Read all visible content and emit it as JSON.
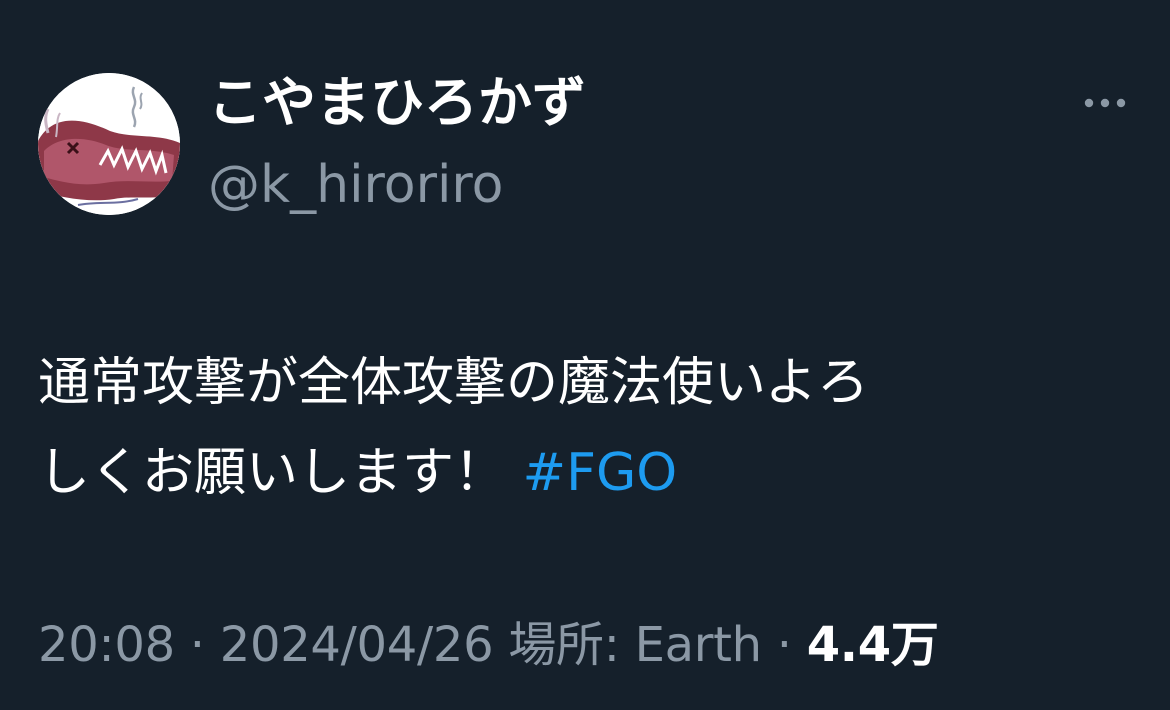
{
  "user": {
    "display_name": "こやまひろかず",
    "handle": "@k_hiroriro",
    "avatar_icon": "user-avatar-illustration"
  },
  "menu": {
    "more_icon": "more-horizontal-icon"
  },
  "tweet": {
    "text_line1": "通常攻撃が全体攻撃の魔法使いよろ",
    "text_line2": "しくお願いします！ ",
    "hashtag": "#FGO"
  },
  "meta": {
    "time": "20:08",
    "separator1": " · ",
    "date": "2024/04/26",
    "location_label": " 場所: Earth",
    "separator2": " · ",
    "views": "4.4万"
  },
  "colors": {
    "background": "#15202b",
    "text": "#ffffff",
    "secondary": "#8b98a5",
    "accent": "#1d9bf0"
  }
}
